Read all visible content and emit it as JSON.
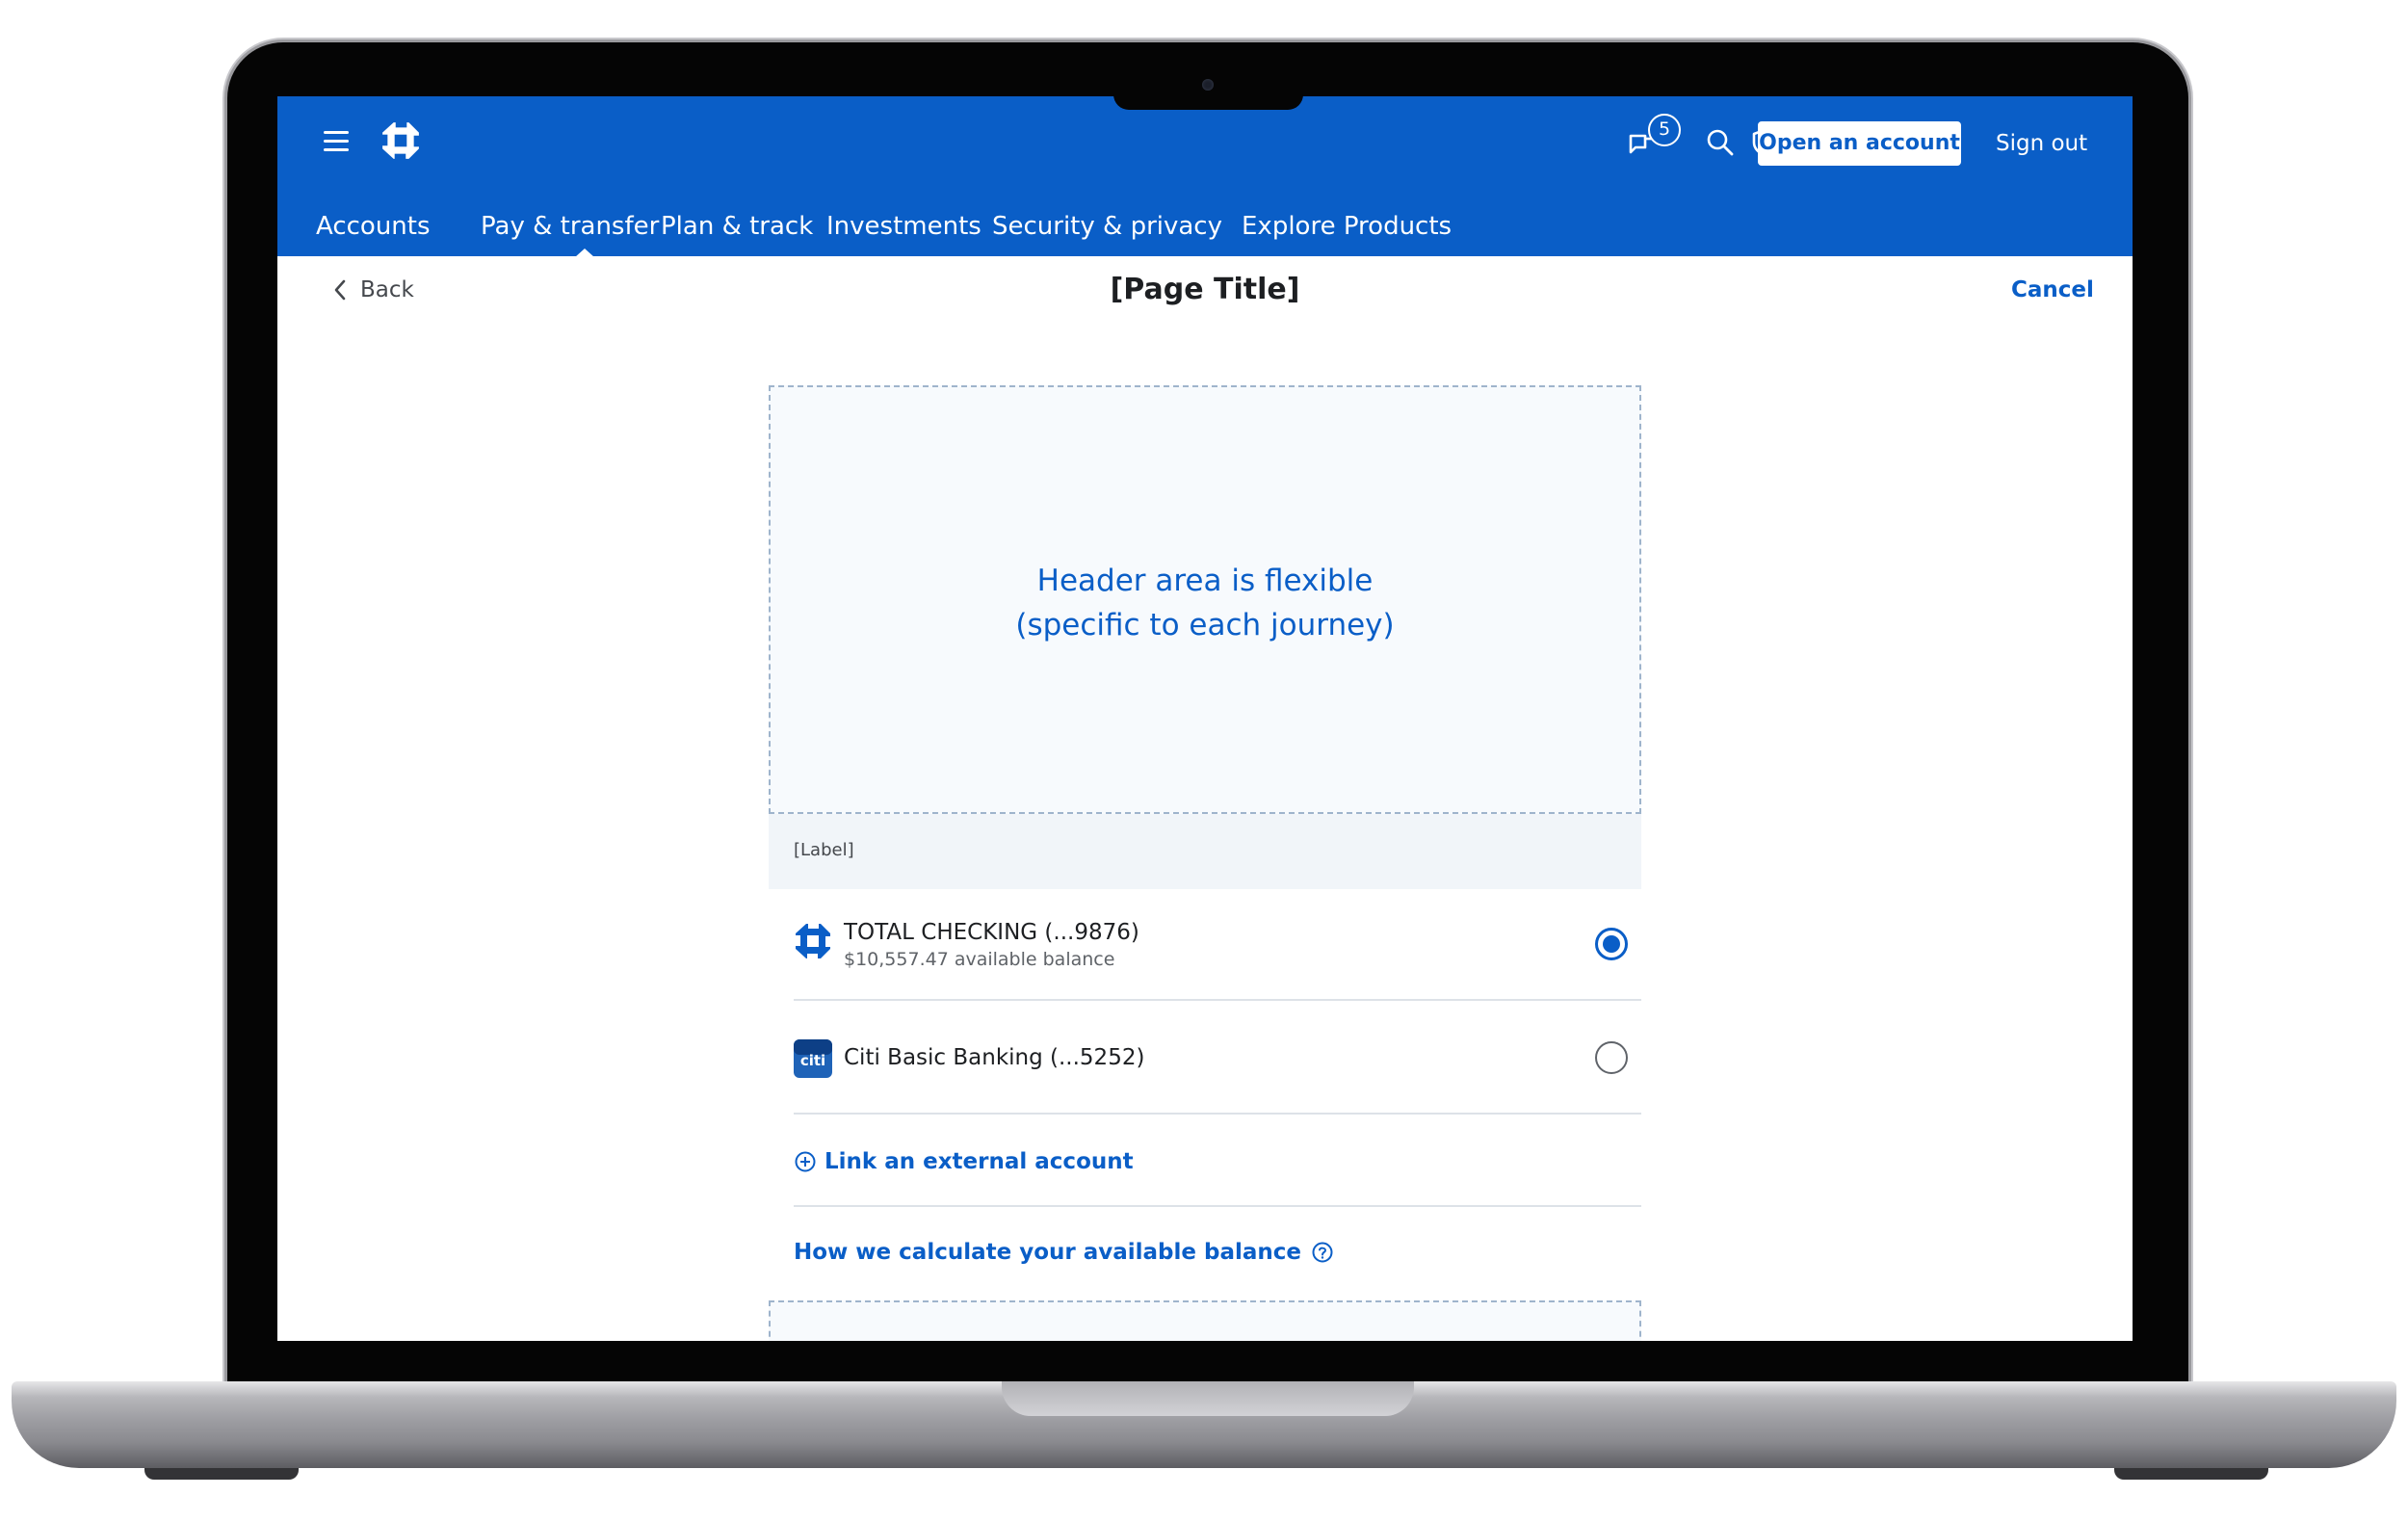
{
  "header": {
    "actions": {
      "notification_count": "5",
      "open_account_label": "Open an account",
      "sign_out_label": "Sign out"
    },
    "nav": [
      {
        "label": "Accounts"
      },
      {
        "label": "Pay & transfer",
        "active": true
      },
      {
        "label": "Plan & track"
      },
      {
        "label": "Investments"
      },
      {
        "label": "Security & privacy"
      },
      {
        "label": "Explore Products"
      }
    ]
  },
  "subheader": {
    "back_label": "Back",
    "title": "[Page Title]",
    "cancel_label": "Cancel"
  },
  "content": {
    "header_area_line1": "Header area is flexible",
    "header_area_line2": "(specific to each journey)",
    "label": "[Label]",
    "accounts": [
      {
        "name": "TOTAL CHECKING (...9876)",
        "balance": "$10,557.47 available balance",
        "selected": true,
        "logo": "chase-octagon-icon"
      },
      {
        "name": "Citi Basic Banking (...5252)",
        "selected": false,
        "logo": "citi-logo-icon",
        "logo_text": "citi"
      }
    ],
    "link_external_label": "Link an external account",
    "how_calc_label": "How we calculate your available balance"
  },
  "icons": [
    "menu-icon",
    "chase-logo-icon",
    "search-icon",
    "shield-icon",
    "notification-flag-icon",
    "profile-icon",
    "chevron-left-icon",
    "plus-circle-icon",
    "help-circle-icon"
  ],
  "colors": {
    "brand_blue": "#0a5ec7",
    "text_dark": "#1d1f22",
    "divider": "#dde2e8",
    "label_bg": "#f1f5f9"
  }
}
